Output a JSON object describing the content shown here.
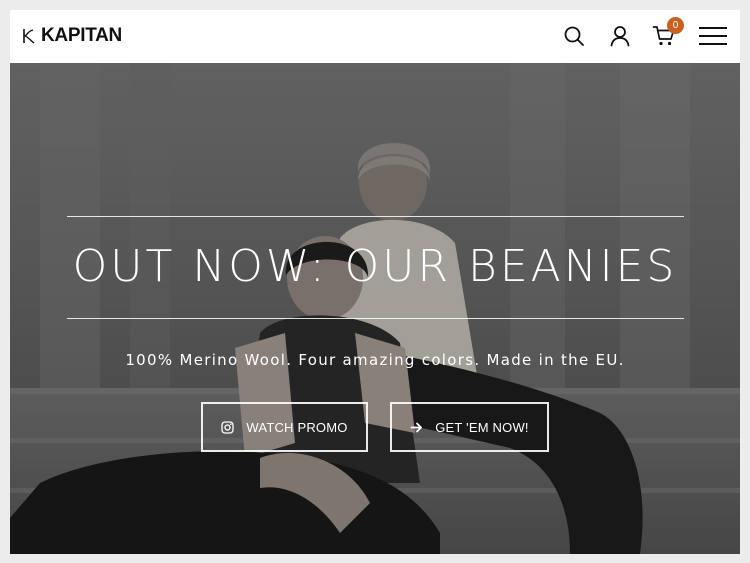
{
  "header": {
    "logo_text": "KAPITAN",
    "cart_count": "0",
    "icons": [
      "search-icon",
      "account-icon",
      "cart-icon",
      "hamburger-menu-icon"
    ]
  },
  "hero": {
    "headline": "OUT NOW: OUR BEANIES",
    "subline": "100% Merino Wool. Four amazing colors. Made in the EU.",
    "buttons": [
      {
        "label": "WATCH PROMO",
        "icon": "instagram-icon"
      },
      {
        "label": "GET 'EM NOW!",
        "icon": "arrow-right-icon"
      }
    ]
  },
  "colors": {
    "badge": "#c8611f",
    "page_background": "#ececec",
    "header_background": "#ffffff"
  }
}
